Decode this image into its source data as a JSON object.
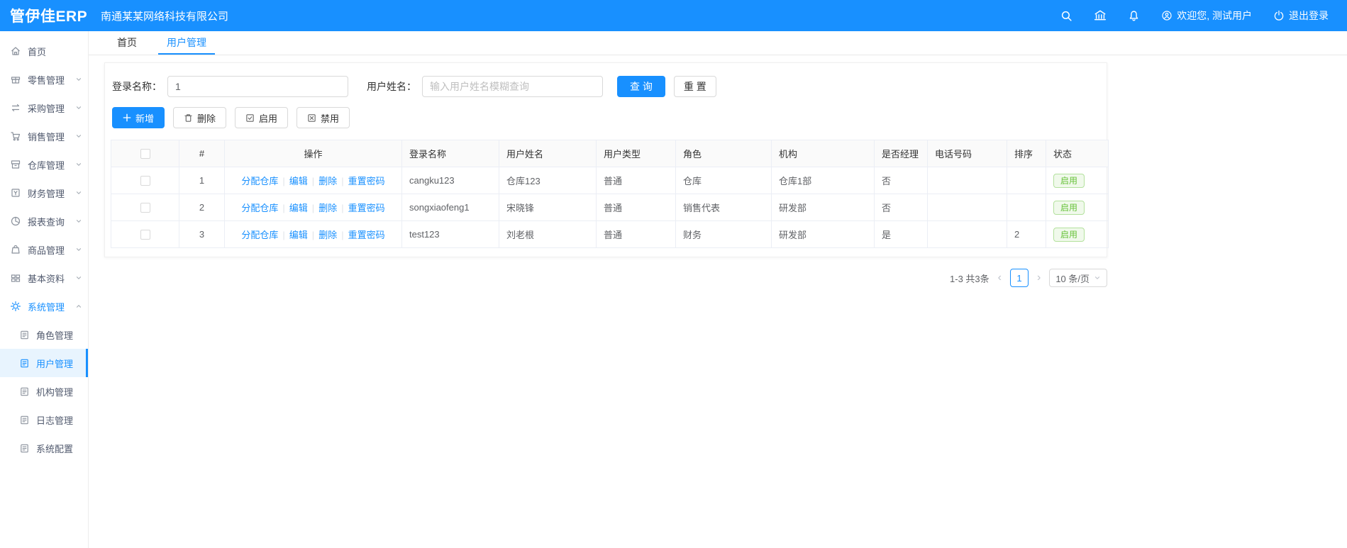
{
  "colors": {
    "primary": "#1890ff",
    "success": "#67c23a",
    "active_menu_bg": "#e8f4fe"
  },
  "header": {
    "logo": "管伊佳ERP",
    "company": "南通某某网络科技有限公司",
    "icons": [
      "search-icon",
      "bank-icon",
      "bell-icon"
    ],
    "welcome": "欢迎您, 测试用户",
    "logout": "退出登录"
  },
  "sidebar": {
    "items": [
      {
        "label": "首页",
        "icon": "home-icon"
      },
      {
        "label": "零售管理",
        "icon": "retail-icon",
        "chevron": "down"
      },
      {
        "label": "采购管理",
        "icon": "purchase-icon",
        "chevron": "down"
      },
      {
        "label": "销售管理",
        "icon": "sales-cart-icon",
        "chevron": "down"
      },
      {
        "label": "仓库管理",
        "icon": "warehouse-icon",
        "chevron": "down"
      },
      {
        "label": "财务管理",
        "icon": "finance-icon",
        "chevron": "down"
      },
      {
        "label": "报表查询",
        "icon": "report-pie-icon",
        "chevron": "down"
      },
      {
        "label": "商品管理",
        "icon": "goods-bag-icon",
        "chevron": "down"
      },
      {
        "label": "基本资料",
        "icon": "grid-icon",
        "chevron": "down"
      },
      {
        "label": "系统管理",
        "icon": "gear-icon",
        "chevron": "up",
        "active": true
      }
    ],
    "subitems": [
      {
        "label": "角色管理",
        "icon": "doc-icon"
      },
      {
        "label": "用户管理",
        "icon": "doc-icon",
        "active": true
      },
      {
        "label": "机构管理",
        "icon": "doc-icon"
      },
      {
        "label": "日志管理",
        "icon": "doc-icon"
      },
      {
        "label": "系统配置",
        "icon": "doc-icon"
      }
    ]
  },
  "tabs": [
    {
      "label": "首页",
      "active": false
    },
    {
      "label": "用户管理",
      "active": true
    }
  ],
  "search": {
    "login_label": "登录名称：",
    "login_value": "1",
    "name_label": "用户姓名：",
    "name_placeholder": "输入用户姓名模糊查询",
    "query_label": "查 询",
    "reset_label": "重 置"
  },
  "toolbar": {
    "add_label": "新增",
    "delete_label": "删除",
    "enable_label": "启用",
    "disable_label": "禁用"
  },
  "table": {
    "headers": {
      "index": "#",
      "ops": "操作",
      "login": "登录名称",
      "name": "用户姓名",
      "type": "用户类型",
      "role": "角色",
      "org": "机构",
      "manager": "是否经理",
      "phone": "电话号码",
      "sort": "排序",
      "status": "状态"
    },
    "ops": [
      "分配仓库",
      "编辑",
      "删除",
      "重置密码"
    ],
    "rows": [
      {
        "index": "1",
        "login": "cangku123",
        "name": "仓库123",
        "type": "普通",
        "role": "仓库",
        "org": "仓库1部",
        "manager": "否",
        "phone": "",
        "sort": "",
        "status": "启用"
      },
      {
        "index": "2",
        "login": "songxiaofeng1",
        "name": "宋晓锋",
        "type": "普通",
        "role": "销售代表",
        "org": "研发部",
        "manager": "否",
        "phone": "",
        "sort": "",
        "status": "启用"
      },
      {
        "index": "3",
        "login": "test123",
        "name": "刘老根",
        "type": "普通",
        "role": "财务",
        "org": "研发部",
        "manager": "是",
        "phone": "",
        "sort": "2",
        "status": "启用"
      }
    ]
  },
  "pagination": {
    "total": "1-3 共3条",
    "prev": "‹",
    "page": "1",
    "next": "›",
    "per_page": "10 条/页"
  }
}
